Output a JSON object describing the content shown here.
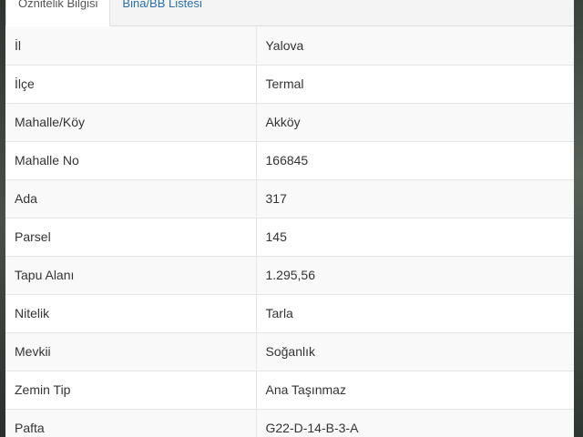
{
  "tabs": [
    {
      "label": "Öznitelik Bilgisi",
      "active": true
    },
    {
      "label": "Bina/BB Listesi",
      "active": false
    }
  ],
  "rows": [
    {
      "key": "İl",
      "value": "Yalova"
    },
    {
      "key": "İlçe",
      "value": "Termal"
    },
    {
      "key": "Mahalle/Köy",
      "value": "Akköy"
    },
    {
      "key": "Mahalle No",
      "value": "166845"
    },
    {
      "key": "Ada",
      "value": "317"
    },
    {
      "key": "Parsel",
      "value": "145"
    },
    {
      "key": "Tapu Alanı",
      "value": "1.295,56"
    },
    {
      "key": "Nitelik",
      "value": "Tarla"
    },
    {
      "key": "Mevkii",
      "value": "Soğanlık"
    },
    {
      "key": "Zemin Tip",
      "value": "Ana Taşınmaz"
    },
    {
      "key": "Pafta",
      "value": "G22-D-14-B-3-A"
    }
  ],
  "colors": {
    "tab_link": "#2a6fb0",
    "text": "#333333",
    "border": "#e6e6e6"
  }
}
